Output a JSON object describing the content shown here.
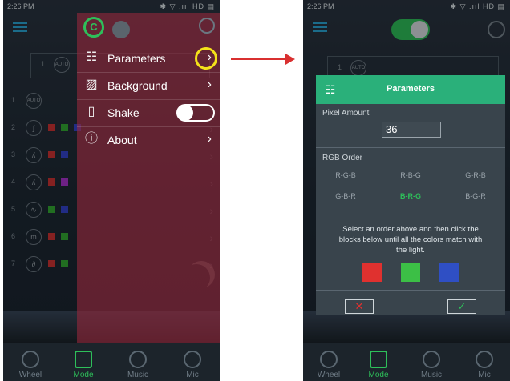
{
  "status_bar": {
    "time": "2:26 PM",
    "icons": "✱ ▽ .ııl HD ▤"
  },
  "left": {
    "rows": [
      {
        "num": "1",
        "icon": "AUTO"
      },
      {
        "num": "2",
        "icon": "ʃ"
      },
      {
        "num": "3",
        "icon": "ʎ"
      },
      {
        "num": "4",
        "icon": "ʎ"
      },
      {
        "num": "5",
        "icon": "∿"
      },
      {
        "num": "6",
        "icon": "m"
      },
      {
        "num": "7",
        "icon": "∂"
      }
    ],
    "top_row": {
      "num": "1",
      "icon": "AUTO"
    },
    "menu": [
      {
        "label": "Parameters",
        "icon": "sliders-icon"
      },
      {
        "label": "Background",
        "icon": "image-icon"
      },
      {
        "label": "Shake",
        "icon": "phone-shake-icon"
      },
      {
        "label": "About",
        "icon": "info-icon"
      }
    ],
    "gear_letter": "C"
  },
  "tabs": [
    {
      "label": "Wheel"
    },
    {
      "label": "Mode"
    },
    {
      "label": "Music"
    },
    {
      "label": "Mic"
    }
  ],
  "dialog": {
    "title": "Parameters",
    "pixel_amount_label": "Pixel Amount",
    "pixel_amount_value": "36",
    "rgb_order_label": "RGB Order",
    "options": [
      "R-G-B",
      "R-B-G",
      "G-R-B",
      "G-B-R",
      "B-R-G",
      "B-G-R"
    ],
    "selected_option": "B-R-G",
    "instructions": "Select an order above and then click the blocks below until all the colors match with the light.",
    "cancel_glyph": "✕",
    "confirm_glyph": "✓"
  },
  "right_top_row": {
    "num": "1",
    "icon": "AUTO"
  },
  "colors": {
    "accent": "#2ebf5a",
    "dialog_header": "#2ab07a",
    "highlight": "#f4e21a",
    "arrow": "#d93030",
    "block_red": "#e0312f",
    "block_green": "#3cbf46",
    "block_blue": "#2f4fc4"
  }
}
